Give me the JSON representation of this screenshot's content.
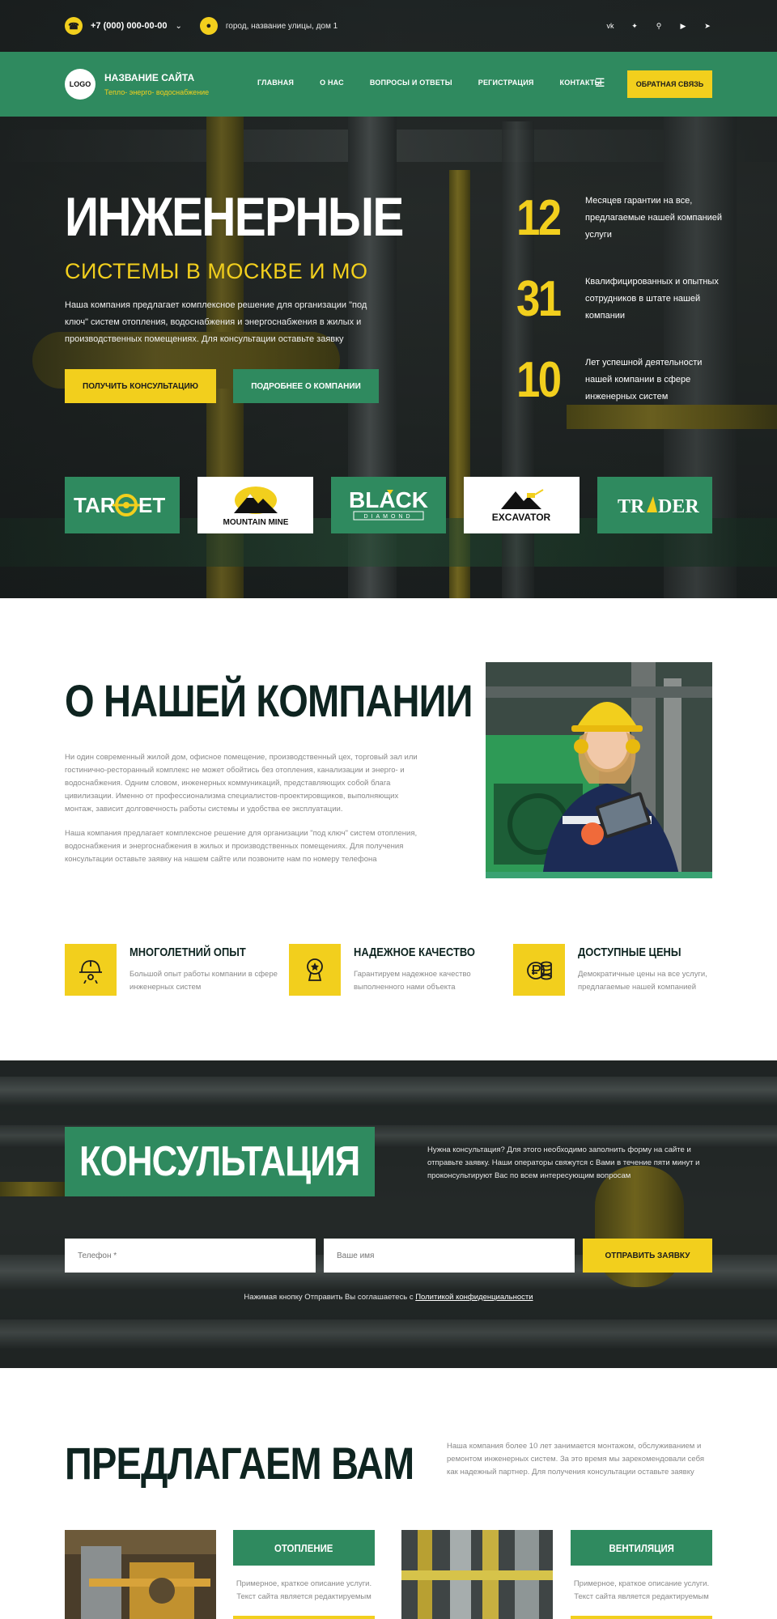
{
  "topbar": {
    "phone": "+7 (000) 000-00-00",
    "address": "город, название улицы, дом 1",
    "socials": [
      "vk-icon",
      "twitter-icon",
      "odnoklassniki-icon",
      "youtube-icon",
      "telegram-icon"
    ]
  },
  "nav": {
    "logo": "LOGO",
    "site_name": "НАЗВАНИЕ САЙТА",
    "site_sub": "Тепло- энерго- водоснабжение",
    "items": [
      "ГЛАВНАЯ",
      "О НАС",
      "ВОПРОСЫ И ОТВЕТЫ",
      "РЕГИСТРАЦИЯ",
      "КОНТАКТЫ"
    ],
    "callback": "ОБРАТНАЯ СВЯЗЬ"
  },
  "hero": {
    "title": "ИНЖЕНЕРНЫЕ",
    "subtitle": "СИСТЕМЫ В МОСКВЕ И МО",
    "text": "Наша компания предлагает комплексное решение для организации \"под ключ\" систем отопления, водоснабжения и энергоснабжения в жилых и производственных помещениях. Для консультации оставьте заявку",
    "btn_primary": "ПОЛУЧИТЬ КОНСУЛЬТАЦИЮ",
    "btn_secondary": "ПОДРОБНЕЕ О КОМПАНИИ",
    "stats": [
      {
        "num": "12",
        "text": "Месяцев гарантии на все, предлагаемые нашей компанией услуги"
      },
      {
        "num": "31",
        "text": "Квалифицированных и опытных сотрудников в штате нашей компании"
      },
      {
        "num": "10",
        "text": "Лет успешной деятельности нашей компании в сфере инженерных систем"
      }
    ],
    "brands": [
      "TARGET",
      "MOUNTAIN MINE",
      "BLACK",
      "DIAMOND",
      "EXCAVATOR",
      "TRADER"
    ]
  },
  "about": {
    "title": "О НАШЕЙ КОМПАНИИ",
    "p1": "Ни один современный жилой дом, офисное помещение, производственный цех, торговый зал или гостинично-ресторанный комплекс не может обойтись без отопления, канализации и энерго- и водоснабжения. Одним словом, инженерных коммуникаций, представляющих собой блага цивилизации. Именно от профессионализма специалистов-проектировщиков, выполняющих монтаж, зависит долговечность работы системы и удобства ее эксплуатации.",
    "p2": "Наша компания предлагает комплексное решение для организации \"под ключ\" систем отопления, водоснабжения и энергоснабжения в жилых и производственных помещениях. Для получения консультации оставьте заявку на нашем сайте или позвоните нам по номеру телефона"
  },
  "features": [
    {
      "icon": "worker-helmet-icon",
      "title": "МНОГОЛЕТНИЙ ОПЫТ",
      "text": "Большой опыт работы компании в сфере инженерных систем"
    },
    {
      "icon": "award-icon",
      "title": "НАДЕЖНОЕ КАЧЕСТВО",
      "text": "Гарантируем надежное качество выполненного нами объекта"
    },
    {
      "icon": "ruble-coins-icon",
      "title": "ДОСТУПНЫЕ ЦЕНЫ",
      "text": "Демократичные цены на все услуги, предлагаемые нашей компанией"
    }
  ],
  "consult": {
    "title": "КОНСУЛЬТАЦИЯ",
    "text": "Нужна консультация? Для этого необходимо заполнить форму на сайте и отправьте заявку. Наши операторы свяжутся с Вами в течение пяти минут и проконсультируют Вас по всем интересующим вопросам",
    "phone_placeholder": "Телефон *",
    "name_placeholder": "Ваше имя",
    "send": "ОТПРАВИТЬ ЗАЯВКУ",
    "agree_text": "Нажимая кнопку Отправить Вы соглашаетесь с ",
    "agree_link": "Политикой конфиденциальности"
  },
  "offer": {
    "title": "ПРЕДЛАГАЕМ ВАМ",
    "text": "Наша компания более 10 лет занимается монтажом, обслуживанием и ремонтом инженерных систем. За это время мы зарекомендовали себя как надежный партнер. Для получения консультации оставьте заявку",
    "services": [
      {
        "title": "ОТОПЛЕНИЕ",
        "desc": "Примерное, краткое описание услуги. Текст сайта является редактируемым"
      },
      {
        "title": "ВЕНТИЛЯЦИЯ",
        "desc": "Примерное, краткое описание услуги. Текст сайта является редактируемым"
      }
    ]
  },
  "colors": {
    "green": "#2f8a5f",
    "yellow": "#f2cf1d",
    "dark": "#0e2420"
  }
}
